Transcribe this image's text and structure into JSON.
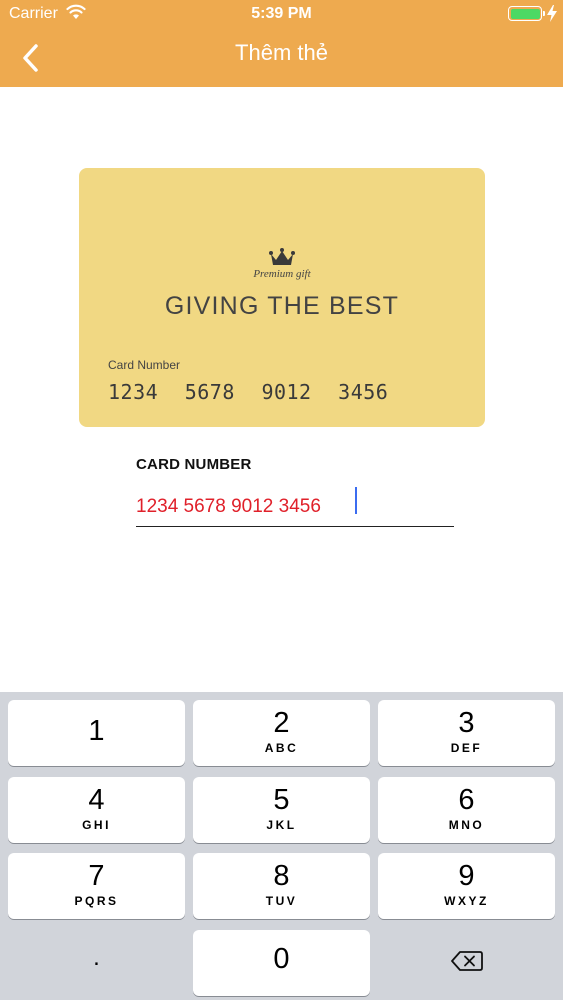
{
  "status_bar": {
    "carrier": "Carrier",
    "time": "5:39 PM"
  },
  "header": {
    "title": "Thêm thẻ"
  },
  "card": {
    "premium_text": "Premium gift",
    "title": "GIVING THE BEST",
    "number_label": "Card Number",
    "number_groups": [
      "1234",
      "5678",
      "9012",
      "3456"
    ]
  },
  "form": {
    "label": "CARD NUMBER",
    "value": "1234 5678 9012 3456"
  },
  "keyboard": {
    "keys": [
      {
        "digit": "1",
        "letters": ""
      },
      {
        "digit": "2",
        "letters": "ABC"
      },
      {
        "digit": "3",
        "letters": "DEF"
      },
      {
        "digit": "4",
        "letters": "GHI"
      },
      {
        "digit": "5",
        "letters": "JKL"
      },
      {
        "digit": "6",
        "letters": "MNO"
      },
      {
        "digit": "7",
        "letters": "PQRS"
      },
      {
        "digit": "8",
        "letters": "TUV"
      },
      {
        "digit": "9",
        "letters": "WXYZ"
      }
    ],
    "zero": "0",
    "dot": "."
  },
  "colors": {
    "header": "#eeaa4f",
    "card": "#f1d883",
    "input_text": "#e0202a",
    "caret": "#3b6cf0"
  }
}
